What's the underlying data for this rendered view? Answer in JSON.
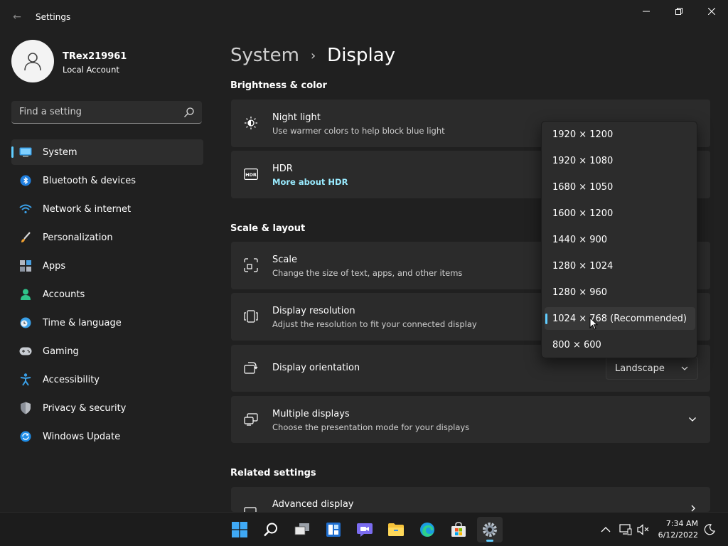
{
  "window": {
    "title": "Settings",
    "back_glyph": "←",
    "controls": [
      "minimize-icon",
      "maximize-icon",
      "close-icon"
    ]
  },
  "profile": {
    "name": "TRex219961",
    "account_type": "Local Account"
  },
  "search": {
    "placeholder": "Find a setting"
  },
  "nav": {
    "items": [
      {
        "label": "System",
        "icon": "system-monitor-icon",
        "active": true
      },
      {
        "label": "Bluetooth & devices",
        "icon": "bluetooth-icon"
      },
      {
        "label": "Network & internet",
        "icon": "wifi-icon"
      },
      {
        "label": "Personalization",
        "icon": "brush-icon"
      },
      {
        "label": "Apps",
        "icon": "apps-icon"
      },
      {
        "label": "Accounts",
        "icon": "person-icon"
      },
      {
        "label": "Time & language",
        "icon": "clock-globe-icon"
      },
      {
        "label": "Gaming",
        "icon": "gamepad-icon"
      },
      {
        "label": "Accessibility",
        "icon": "accessibility-icon"
      },
      {
        "label": "Privacy & security",
        "icon": "shield-icon"
      },
      {
        "label": "Windows Update",
        "icon": "update-icon"
      }
    ]
  },
  "breadcrumb": {
    "parent": "System",
    "separator": "›",
    "current": "Display"
  },
  "sections": {
    "brightness": "Brightness & color",
    "scale_layout": "Scale & layout",
    "related": "Related settings"
  },
  "cards": {
    "night_light": {
      "title": "Night light",
      "subtitle": "Use warmer colors to help block blue light"
    },
    "hdr": {
      "title": "HDR",
      "link": "More about HDR"
    },
    "scale": {
      "title": "Scale",
      "subtitle": "Change the size of text, apps, and other items"
    },
    "resolution": {
      "title": "Display resolution",
      "subtitle": "Adjust the resolution to fit your connected display"
    },
    "orientation": {
      "title": "Display orientation",
      "value": "Landscape"
    },
    "multiple": {
      "title": "Multiple displays",
      "subtitle": "Choose the presentation mode for your displays"
    },
    "advanced": {
      "title": "Advanced display"
    }
  },
  "resolution_dropdown": {
    "options": [
      "1920 × 1200",
      "1920 × 1080",
      "1680 × 1050",
      "1600 × 1200",
      "1440 × 900",
      "1280 × 1024",
      "1280 × 960",
      "1024 × 768 (Recommended)",
      "800 × 600"
    ],
    "selected_index": 7
  },
  "taskbar": {
    "apps": [
      "windows-start-icon",
      "search-icon",
      "task-view-icon",
      "widgets-icon",
      "chat-icon",
      "file-explorer-icon",
      "edge-icon",
      "store-icon",
      "settings-icon"
    ],
    "active_app": "settings-icon",
    "time": "7:34 AM",
    "date": "6/12/2022"
  },
  "colors": {
    "accent": "#60cdff",
    "link": "#99ebff",
    "background": "#202020",
    "card": "#2b2b2b"
  }
}
